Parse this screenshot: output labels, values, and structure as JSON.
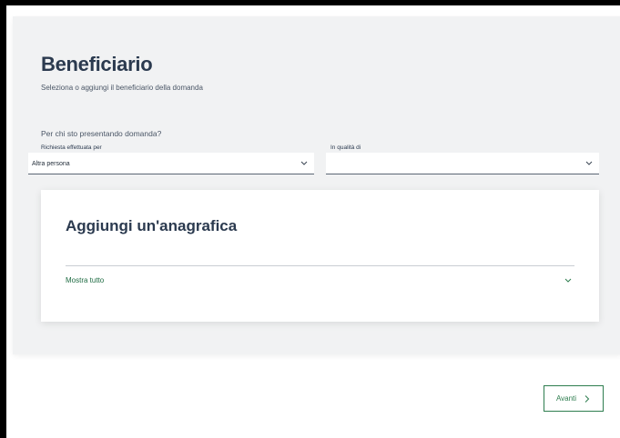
{
  "header": {
    "title": "Beneficiario",
    "subtitle": "Seleziona o aggiungi il beneficiario della domanda"
  },
  "form": {
    "question": "Per chi sto presentando domanda?",
    "request_field": {
      "label": "Richiesta effettuata per",
      "value": "Altra persona",
      "icon": "chevron-down-icon"
    },
    "capacity_field": {
      "label": "In qualità di",
      "value": "",
      "icon": "chevron-down-icon"
    }
  },
  "card": {
    "title": "Aggiungi un'anagrafica",
    "show_all_label": "Mostra tutto",
    "show_all_icon": "chevron-down-icon"
  },
  "footer": {
    "next_label": "Avanti",
    "next_icon": "chevron-right-icon"
  },
  "colors": {
    "accent_green": "#2e7d4f",
    "link_green": "#1e6b42",
    "title_text": "#2b3a4f",
    "panel_background": "#f1f2f3"
  }
}
